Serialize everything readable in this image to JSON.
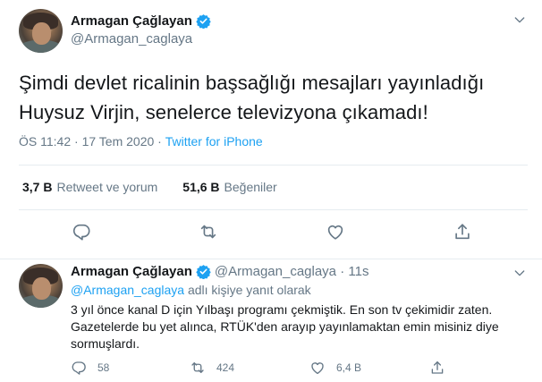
{
  "main": {
    "author": {
      "name": "Armagan Çağlayan",
      "handle": "@Armagan_caglaya"
    },
    "text_line1": "Şimdi devlet ricalinin başsağlığı mesajları yayınladığı",
    "text_line2": "Huysuz Virjin, senelerce televizyona çıkamadı!",
    "time": "ÖS 11:42",
    "dot": " · ",
    "date": "17 Tem 2020",
    "source": "Twitter for iPhone",
    "stats": {
      "retweets_count": "3,7 B",
      "retweets_label": "Retweet ve yorum",
      "likes_count": "51,6 B",
      "likes_label": "Beğeniler"
    }
  },
  "reply": {
    "author": {
      "name": "Armagan Çağlayan",
      "handle": "@Armagan_caglaya",
      "dot": " · ",
      "time": "11s"
    },
    "replying_to_mention": "@Armagan_caglaya",
    "replying_to_suffix": " adlı kişiye yanıt olarak",
    "text": "3 yıl önce kanal D için Yılbaşı programı çekmiştik. En son tv çekimidir zaten. Gazetelerde bu yet alınca, RTÜK'den arayıp yayınlamaktan emin misiniz diye sormuşlardı.",
    "counts": {
      "replies": "58",
      "retweets": "424",
      "likes": "6,4 B"
    }
  },
  "icons": {
    "verified": "verified-badge-icon",
    "caret": "chevron-down-icon",
    "reply": "reply-icon",
    "retweet": "retweet-icon",
    "like": "heart-icon",
    "share": "share-icon"
  },
  "colors": {
    "accent": "#1da1f2",
    "text": "#14171a",
    "muted": "#657786",
    "border": "#e6ecf0"
  }
}
